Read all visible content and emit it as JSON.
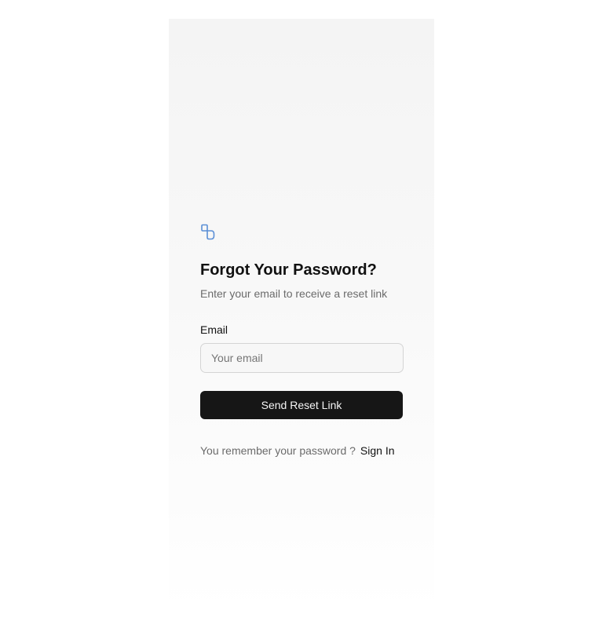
{
  "form": {
    "title": "Forgot Your Password?",
    "subtitle": "Enter your email to receive a reset link",
    "email_label": "Email",
    "email_placeholder": "Your email",
    "email_value": "",
    "submit_label": "Send Reset Link"
  },
  "footer": {
    "prompt": "You remember your password ?",
    "sign_in_label": "Sign In"
  },
  "colors": {
    "logo": "#5b8fd6",
    "button_bg": "#161616",
    "muted_text": "#6b6b6b"
  },
  "icons": {
    "logo": "brand-logo-icon"
  }
}
